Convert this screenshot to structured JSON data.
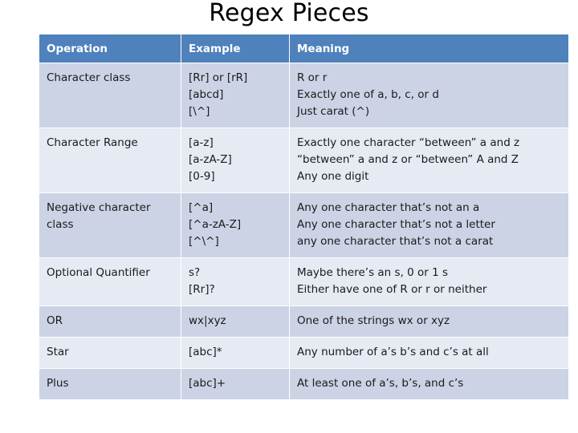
{
  "slide": {
    "title": "Regex Pieces",
    "accent_color": "#4f81bd",
    "band_color_a": "#ccd3e5",
    "band_color_b": "#e6eaf3",
    "header_text_color": "#ffffff"
  },
  "table": {
    "columns": [
      {
        "key": "operation",
        "label": "Operation"
      },
      {
        "key": "example",
        "label": "Example"
      },
      {
        "key": "meaning",
        "label": "Meaning"
      }
    ],
    "rows": [
      {
        "operation": "Character class",
        "example": [
          "[Rr] or [rR]",
          "[abcd]",
          "[\\^]"
        ],
        "meaning": [
          "R or r",
          "Exactly one of a, b, c, or d",
          "Just carat (^)"
        ]
      },
      {
        "operation": "Character Range",
        "example": [
          "[a-z]",
          "[a-zA-Z]",
          "[0-9]"
        ],
        "meaning": [
          "Exactly one character “between” a and z",
          "“between” a and z or “between” A and Z",
          "Any one digit"
        ]
      },
      {
        "operation": "Negative character class",
        "example": [
          "[^a]",
          "[^a-zA-Z]",
          "[^\\^]"
        ],
        "meaning": [
          "Any one character that’s not an a",
          "Any one character that’s not a letter",
          "any one character that’s not a carat"
        ]
      },
      {
        "operation": "Optional Quantifier",
        "example": [
          "s?",
          "[Rr]?"
        ],
        "meaning": [
          "Maybe there’s an s, 0 or 1 s",
          "Either have one of R or r or neither"
        ]
      },
      {
        "operation": "OR",
        "example": [
          "wx|xyz"
        ],
        "meaning": [
          "One of the strings wx or xyz"
        ]
      },
      {
        "operation": "Star",
        "example": [
          "[abc]*"
        ],
        "meaning": [
          "Any number of a’s b’s and c’s at all"
        ]
      },
      {
        "operation": "Plus",
        "example": [
          "[abc]+"
        ],
        "meaning": [
          "At least one of a’s, b’s, and c’s"
        ]
      }
    ]
  }
}
